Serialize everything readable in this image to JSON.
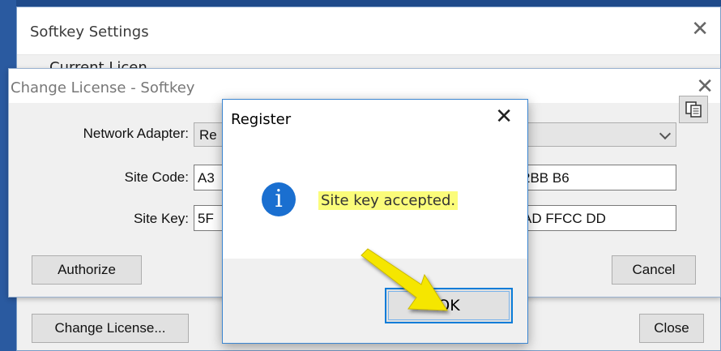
{
  "settings_window": {
    "title": "Softkey Settings",
    "partial_text": "Current Licen",
    "change_license_button": "Change License...",
    "close_button": "Close"
  },
  "change_license_window": {
    "title": "Change License - Softkey",
    "network_adapter_label": "Network Adapter:",
    "network_adapter_value_left": "Re",
    "site_code_label": "Site Code:",
    "site_code_value_left": "A3",
    "site_code_value_right": "2BB B6",
    "site_key_label": "Site Key:",
    "site_key_value_left": "5F",
    "site_key_value_right": "AD FFCC DD",
    "authorize_button": "Authorize",
    "cancel_button": "Cancel"
  },
  "register_dialog": {
    "title": "Register",
    "message": "Site key accepted.",
    "ok_button": "OK",
    "icon": "info-icon"
  },
  "colors": {
    "highlight": "#fbfc7a",
    "accent": "#0a7cd8",
    "arrow": "#f5e600"
  }
}
